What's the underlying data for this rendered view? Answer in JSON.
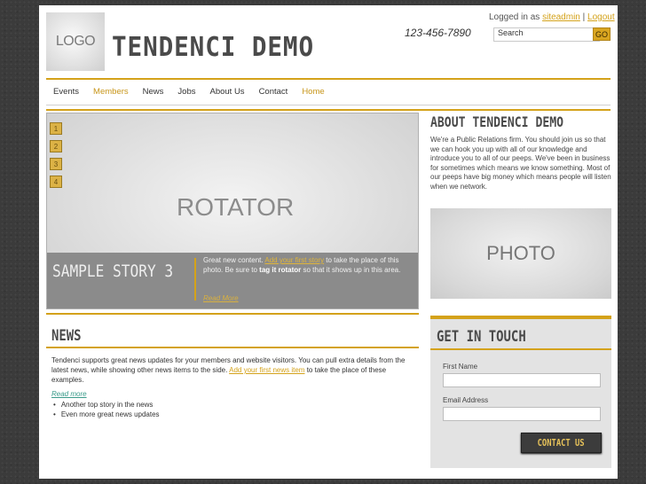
{
  "header": {
    "logo_text": "LOGO",
    "site_title": "TENDENCI DEMO",
    "phone": "123-456-7890",
    "login_prefix": "Logged in as",
    "login_user": "siteadmin",
    "login_sep": "|",
    "logout_label": "Logout",
    "search_value": "Search",
    "go_label": "GO"
  },
  "nav": {
    "items": [
      "Events",
      "Members",
      "News",
      "Jobs",
      "About Us",
      "Contact",
      "Home"
    ],
    "active_index": 1
  },
  "rotator": {
    "label": "ROTATOR",
    "numbers": [
      "1",
      "2",
      "3",
      "4"
    ],
    "story_title": "SAMPLE STORY 3",
    "story_text_1": "Great new content. ",
    "story_link": "Add your first story",
    "story_text_2": " to take the place of this photo. Be sure to ",
    "story_bold": "tag it rotator",
    "story_text_3": " so that it shows up in this area.",
    "read_more": "Read More"
  },
  "about": {
    "title": "ABOUT TENDENCI DEMO",
    "text": "We're a Public Relations firm. You should join us so that we can hook you up with all of our knowledge and introduce you to all of our peeps. We've been in business for sometimes which means we know something. Most of our peeps have big money which means people will listen when we network.",
    "photo_label": "PHOTO"
  },
  "news": {
    "title": "NEWS",
    "text": "Tendenci supports great news updates for your members and website visitors. You can pull extra details from the latest news, while showing other news items to the side. ",
    "link": "Add your first news item",
    "text_2": " to take the place of these examples.",
    "read_more": "Read more",
    "items": [
      "Another top story in the news",
      "Even more great news updates"
    ]
  },
  "contact": {
    "title": "GET IN TOUCH",
    "first_name_label": "First Name",
    "email_label": "Email Address",
    "button_label": "CONTACT US"
  },
  "colors": {
    "accent": "#d4a21a",
    "background": "#3b3b3b",
    "rotator_bar": "#8b8b8b",
    "button": "#3c3c3c"
  }
}
